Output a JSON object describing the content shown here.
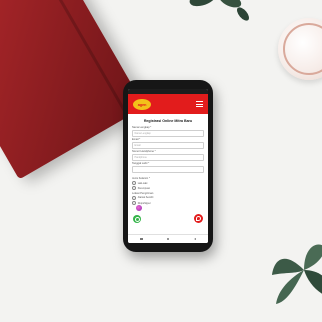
{
  "app": {
    "logo_text": "agen"
  },
  "form": {
    "title": "Registrasi Online Mitra Baru",
    "fields": [
      {
        "label": "Nama Lengkap *",
        "placeholder": "Nama Lengkap"
      },
      {
        "label": "Email *",
        "placeholder": "Email"
      },
      {
        "label": "Nomor Handphone *",
        "placeholder": "Handphone"
      },
      {
        "label": "Tanggal Lahir *",
        "placeholder": ""
      }
    ],
    "gender_label": "Jenis Kelamin *",
    "gender_options": [
      "Laki-Laki",
      "Perempuan"
    ],
    "account_label": "Lokasi Pengiriman",
    "account_options": [
      "Alamat Sendiri",
      "Dropshipper"
    ]
  },
  "colors": {
    "brand_red": "#e21c1c",
    "brand_yellow": "#f3c11a",
    "whatsapp_green": "#35b44a"
  },
  "icons": {
    "menu": "hamburger-icon",
    "whatsapp": "whatsapp-icon",
    "chat": "chat-icon"
  }
}
